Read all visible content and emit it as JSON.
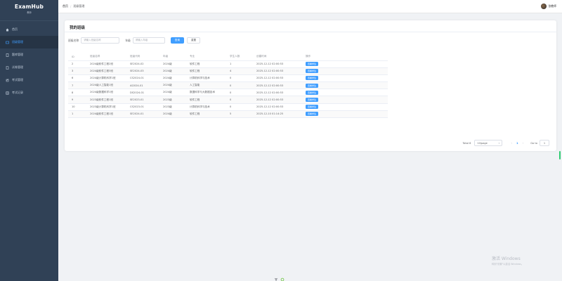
{
  "app": {
    "title": "ExamHub",
    "subtitle": "教师"
  },
  "sidebar": {
    "items": [
      {
        "label": "首页",
        "icon": "home-icon",
        "active": false
      },
      {
        "label": "班级管理",
        "icon": "class-icon",
        "active": true
      },
      {
        "label": "题库管理",
        "icon": "bank-icon",
        "active": false
      },
      {
        "label": "试卷管理",
        "icon": "paper-icon",
        "active": false
      },
      {
        "label": "考试管理",
        "icon": "exam-icon",
        "active": false
      },
      {
        "label": "考试记录",
        "icon": "record-icon",
        "active": false
      }
    ]
  },
  "header": {
    "breadcrumb": [
      "首页",
      "班级管理"
    ],
    "username": "张教师"
  },
  "main": {
    "title": "我的班级",
    "filters": {
      "name_label": "班级名称",
      "name_placeholder": "请输入班级名称",
      "grade_label": "年级",
      "grade_placeholder": "请输入年级",
      "search_label": "查询",
      "reset_label": "重置"
    },
    "table": {
      "columns": [
        "ID",
        "班级名称",
        "班级代码",
        "年级",
        "专业",
        "学生人数",
        "创建时间",
        "操作"
      ],
      "rows": [
        [
          "2",
          "2024级软件工程2班",
          "SE2024-02",
          "2024级",
          "软件工程",
          "1",
          "2025-12-12 02:00:53"
        ],
        [
          "3",
          "2024级软件工程3班",
          "SE2024-03",
          "2024级",
          "软件工程",
          "4",
          "2025-12-12 02:00:53"
        ],
        [
          "6",
          "2024级计算机科学1班",
          "CS2024-01",
          "2024级",
          "计算机科学与技术",
          "0",
          "2025-12-12 02:00:53"
        ],
        [
          "7",
          "2024级人工智能1班",
          "AI2024-01",
          "2024级",
          "人工智能",
          "0",
          "2025-12-12 02:00:53"
        ],
        [
          "8",
          "2024级数据科学1班",
          "DS2024-01",
          "2024级",
          "数据科学与大数据技术",
          "0",
          "2025-12-12 02:00:53"
        ],
        [
          "9",
          "2023级软件工程1班",
          "SE2023-01",
          "2023级",
          "软件工程",
          "0",
          "2025-12-12 02:00:53"
        ],
        [
          "10",
          "2023级计算机科学1班",
          "CS2023-01",
          "2023级",
          "计算机科学与技术",
          "0",
          "2025-12-12 02:00:53"
        ],
        [
          "1",
          "2024级软件工程1班",
          "SE2024-01",
          "2024级",
          "软件工程",
          "5",
          "2025-12-10 01:14:25"
        ]
      ],
      "action_label": "查看学生"
    },
    "pagination": {
      "total": "Total 8",
      "page_size": "10/page",
      "current_page": "1",
      "goto_label": "Go to",
      "goto_value": "1"
    }
  },
  "watermark": {
    "line1": "激活 Windows",
    "line2": "转到\"设置\"以激活 Windows。"
  },
  "colors": {
    "sidebar": "#304156",
    "primary": "#409eff"
  }
}
